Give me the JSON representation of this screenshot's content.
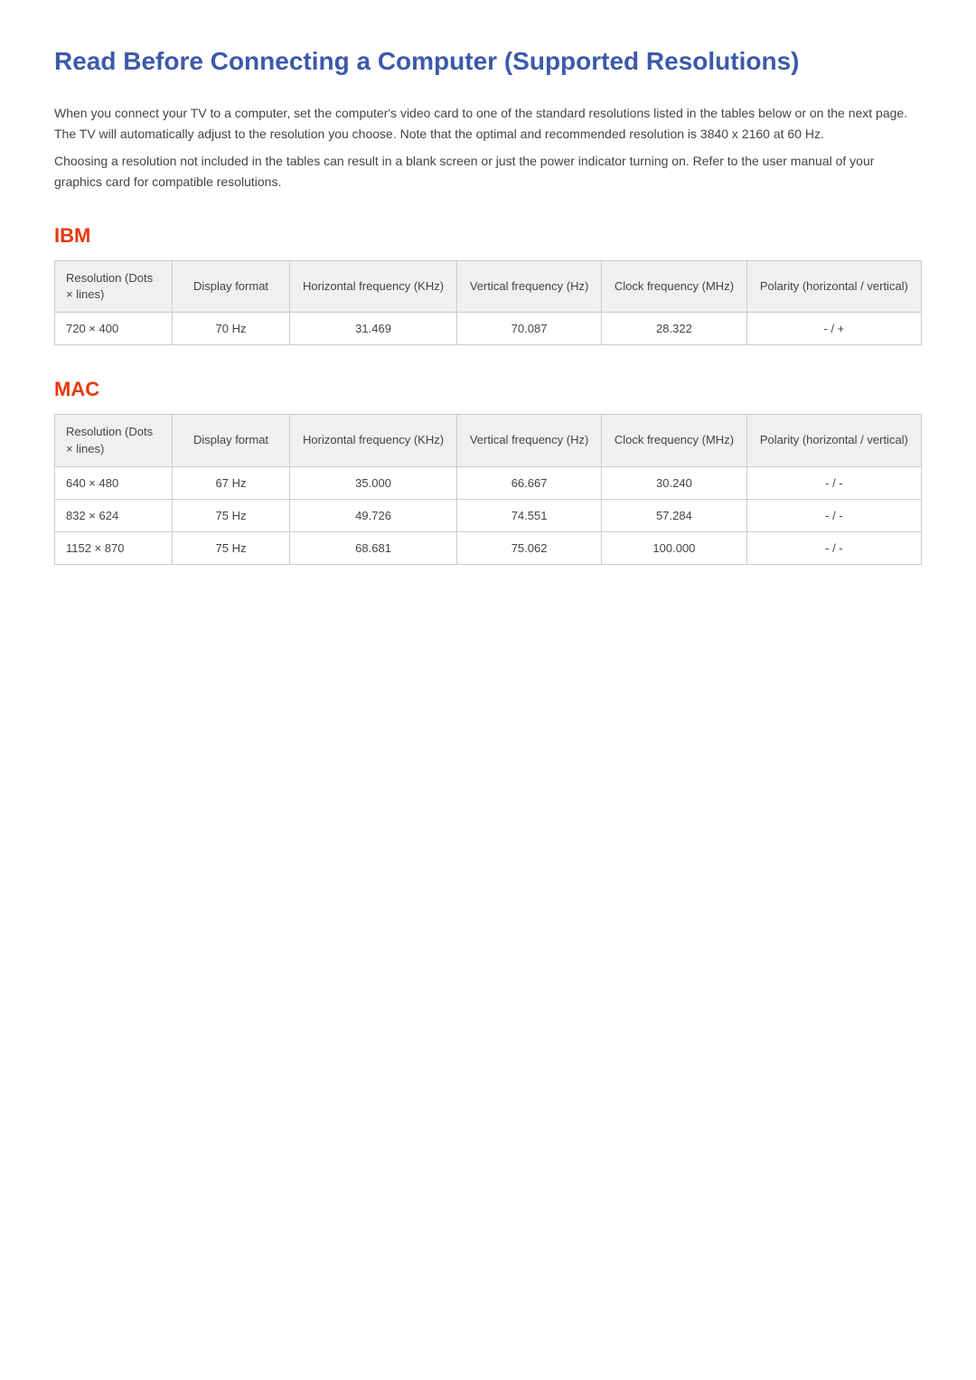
{
  "page": {
    "title": "Read Before Connecting a Computer (Supported Resolutions)",
    "intro1": "When you connect your TV to a computer, set the computer's video card to one of the standard resolutions listed in the tables below or on the next page. The TV will automatically adjust to the resolution you choose. Note that the optimal and recommended resolution is 3840 x 2160 at 60 Hz.",
    "intro2": "Choosing a resolution not included in the tables can result in a blank screen or just the power indicator turning on. Refer to the user manual of your graphics card for compatible resolutions."
  },
  "ibm": {
    "title": "IBM",
    "headers": {
      "resolution": "Resolution (Dots × lines)",
      "display_format": "Display format",
      "horizontal": "Horizontal frequency (KHz)",
      "vertical": "Vertical frequency (Hz)",
      "clock": "Clock frequency (MHz)",
      "polarity": "Polarity (horizontal / vertical)"
    },
    "rows": [
      {
        "resolution": "720 × 400",
        "display_format": "70 Hz",
        "horizontal": "31.469",
        "vertical": "70.087",
        "clock": "28.322",
        "polarity": "- / +"
      }
    ]
  },
  "mac": {
    "title": "MAC",
    "headers": {
      "resolution": "Resolution (Dots × lines)",
      "display_format": "Display format",
      "horizontal": "Horizontal frequency (KHz)",
      "vertical": "Vertical frequency (Hz)",
      "clock": "Clock frequency (MHz)",
      "polarity": "Polarity (horizontal / vertical)"
    },
    "rows": [
      {
        "resolution": "640 × 480",
        "display_format": "67 Hz",
        "horizontal": "35.000",
        "vertical": "66.667",
        "clock": "30.240",
        "polarity": "- / -"
      },
      {
        "resolution": "832 × 624",
        "display_format": "75 Hz",
        "horizontal": "49.726",
        "vertical": "74.551",
        "clock": "57.284",
        "polarity": "- / -"
      },
      {
        "resolution": "1152 × 870",
        "display_format": "75 Hz",
        "horizontal": "68.681",
        "vertical": "75.062",
        "clock": "100.000",
        "polarity": "- / -"
      }
    ]
  }
}
